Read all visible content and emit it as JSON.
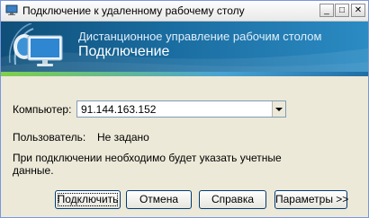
{
  "window": {
    "title": "Подключение к удаленному рабочему столу",
    "minimize_glyph": "_",
    "maximize_glyph": "□",
    "close_glyph": "✕"
  },
  "banner": {
    "line1": "Дистанционное управление рабочим столом",
    "line2": "Подключение"
  },
  "form": {
    "computer_label": "Компьютер:",
    "computer_value": "91.144.163.152",
    "user_label": "Пользователь:",
    "user_value": "Не задано",
    "info_text": "При подключении необходимо будет указать учетные данные."
  },
  "buttons": {
    "connect": "Подключить",
    "cancel": "Отмена",
    "help": "Справка",
    "options": "Параметры >>"
  },
  "colors": {
    "banner_dark": "#0f4f79",
    "banner_light": "#2b8bc3",
    "window_bg": "#ece9d8"
  }
}
